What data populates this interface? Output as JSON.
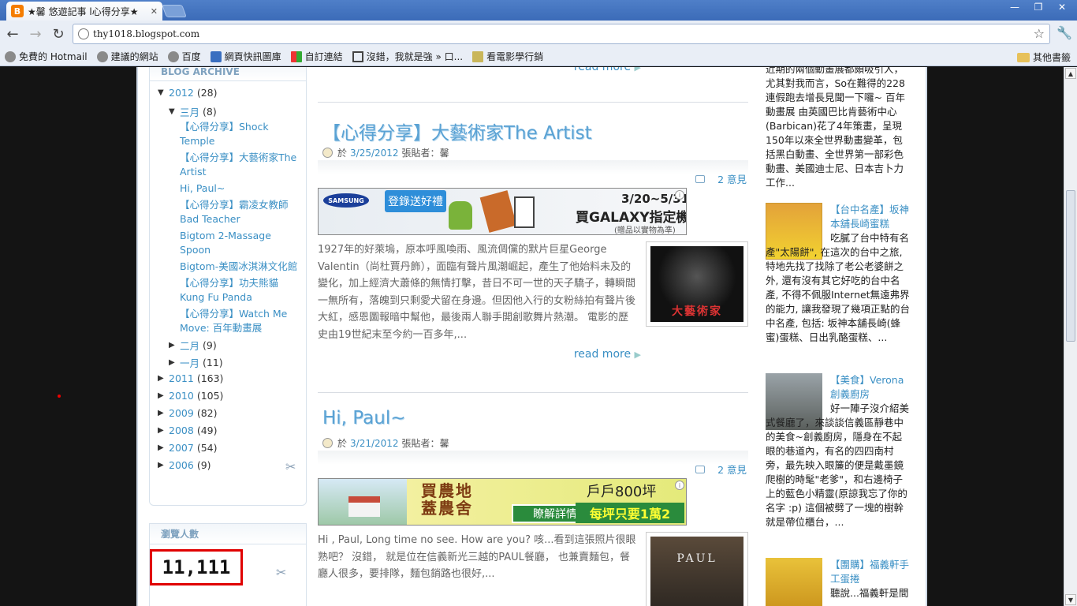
{
  "browser": {
    "tab_title": "★馨 悠遊記事 l心得分享★",
    "url": "thy1018.blogspot.com",
    "window_buttons": [
      "—",
      "❐",
      "✕"
    ],
    "bookmarks": [
      {
        "label": "免費的 Hotmail",
        "icon": "globe-icon"
      },
      {
        "label": "建議的網站",
        "icon": "globe-icon"
      },
      {
        "label": "百度",
        "icon": "globe-icon"
      },
      {
        "label": "網頁快訊圖庫",
        "icon": "page-icon"
      },
      {
        "label": "自訂連結",
        "icon": "windows-icon"
      },
      {
        "label": "沒錯，我就是強 » 口...",
        "icon": "grid-icon"
      },
      {
        "label": "看電影學行銷",
        "icon": "doc-icon"
      }
    ],
    "other_bookmarks": "其他書籤"
  },
  "left_sidebar": {
    "archive_title": "BLOG ARCHIVE",
    "years": [
      {
        "tri": "▼",
        "year": "2012",
        "count": "(28)"
      },
      {
        "tri": "▶",
        "year": "2011",
        "count": "(163)"
      },
      {
        "tri": "▶",
        "year": "2010",
        "count": "(105)"
      },
      {
        "tri": "▶",
        "year": "2009",
        "count": "(82)"
      },
      {
        "tri": "▶",
        "year": "2008",
        "count": "(49)"
      },
      {
        "tri": "▶",
        "year": "2007",
        "count": "(54)"
      },
      {
        "tri": "▶",
        "year": "2006",
        "count": "(9)"
      }
    ],
    "months": [
      {
        "tri": "▼",
        "month": "三月",
        "count": "(8)"
      },
      {
        "tri": "▶",
        "month": "二月",
        "count": "(9)"
      },
      {
        "tri": "▶",
        "month": "一月",
        "count": "(11)"
      }
    ],
    "march_posts": [
      "【心得分享】Shock Temple",
      "【心得分享】大藝術家The Artist",
      "Hi, Paul~",
      "【心得分享】霸凌女教師 Bad Teacher",
      "Bigtom 2-Massage Spoon",
      "Bigtom-美國冰淇淋文化館",
      "【心得分享】功夫熊貓 Kung Fu Panda",
      "【心得分享】Watch Me Move: 百年動畫展"
    ],
    "counter_title": "瀏覽人數",
    "counter_value": "11,111"
  },
  "main": {
    "read_more": "read more",
    "posts": [
      {
        "title": "【心得分享】大藝術家The Artist",
        "meta_prefix": "於",
        "date": "3/25/2012",
        "author_label": "張貼者：",
        "author": "馨",
        "comments": "2 意見",
        "excerpt": "1927年的好萊塢，原本呼風喚雨、風流倜儻的默片巨星George Valentin（尚杜賈丹飾），面臨有聲片風潮崛起，產生了他始料未及的變化，加上經濟大蕭條的無情打擊，昔日不可一世的天子驕子，轉瞬間一無所有，落魄到只剩愛犬留在身邊。但因他入行的女粉絲拍有聲片後大紅，感恩圖報暗中幫他，最後兩人聯手開創歌舞片熱潮。 電影的歷史由19世紀末至今約一百多年,...",
        "thumb_text": "大藝術家",
        "ad": {
          "brand": "SAMSUNG",
          "button": "登錄送好禮",
          "date": "3/20~5/31",
          "headline": "買GALAXY指定機種",
          "note": "(贈品以實物為準)"
        }
      },
      {
        "title": "Hi, Paul~",
        "meta_prefix": "於",
        "date": "3/21/2012",
        "author_label": "張貼者：",
        "author": "馨",
        "comments": "2 意見",
        "excerpt": "Hi , Paul, Long time no see.  How are you? 咳...看到這張照片很眼熟吧？ 沒錯， 就是位在信義新光三越的PAUL餐廳， 也兼賣麵包，餐廳人很多，要排隊，麵包銷路也很好,...",
        "thumb_text": "PAUL",
        "ad": {
          "headline": "買農地蓋農舍",
          "button": "瞭解詳情",
          "price": "戶戶800坪",
          "promo": "每坪只要1萬2"
        }
      }
    ]
  },
  "right_sidebar": {
    "top_text": "近期的兩個動畫展都頗吸引人，尤其對我而言，So在難得的228連假跑去增長見聞一下囉~ 百年動畫展 由英國巴比肯藝術中心(Barbican)花了4年策畫，呈現150年以來全世界動畫變革，包括黑白動畫、全世界第一部彩色動畫、美國迪士尼、日本吉卜力工作...",
    "items": [
      {
        "title": "【台中名產】坂神本舖長崎蜜糕",
        "text": "吃膩了台中特有名產\"太陽餅\", 在這次的台中之旅, 特地先找了找除了老公老婆餅之外, 還有沒有其它好吃的台中名產, 不得不佩服Internet無遠弗界的能力, 讓我發現了幾項正點的台中名產, 包括: 坂神本舖長崎(蜂蜜)蛋糕、日出乳酪蛋糕、..."
      },
      {
        "title": "【美食】Verona 創義廚房",
        "text": "好一陣子沒介紹美式餐廳了，來談談信義區靜巷中的美食~創義廚房，隱身在不起眼的巷道內，有名的四四南村旁，最先映入眼簾的便是戴墨鏡爬樹的時髦\"老爹\"，和右邊椅子上的藍色小精靈(原諒我忘了你的名字 :p) 這個被劈了一塊的樹幹就是帶位櫃台，..."
      },
      {
        "title": "【團購】福義軒手工蛋捲",
        "text": "聽說...福義軒是間"
      }
    ]
  }
}
